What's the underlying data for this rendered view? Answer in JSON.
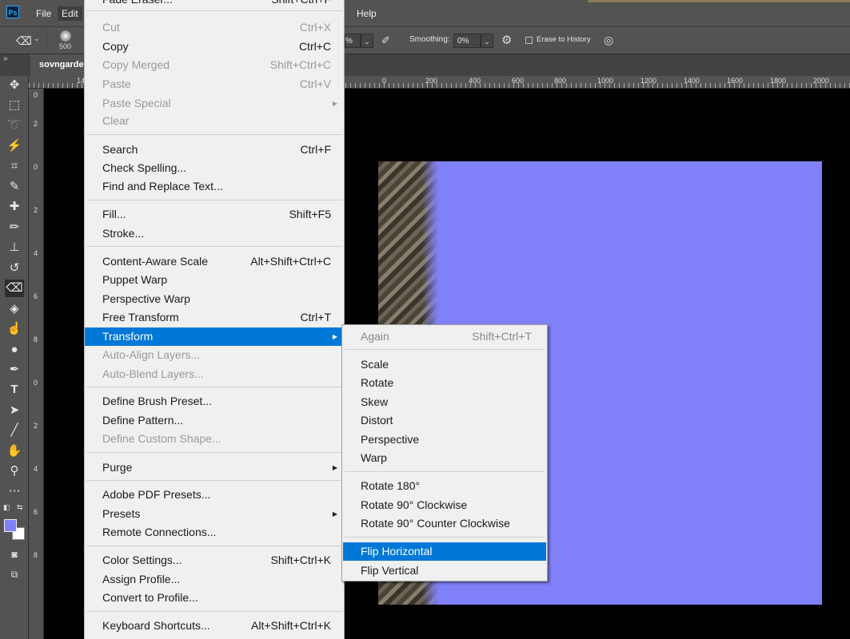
{
  "app": {
    "logo": "Ps"
  },
  "menubar": {
    "items": [
      "File",
      "Edit"
    ],
    "right_items": [
      "Help"
    ]
  },
  "options": {
    "brush_size": "500",
    "opacity_value": "%",
    "smoothing_label": "Smoothing:",
    "smoothing_value": "0%",
    "erase_to_history": "Erase to History",
    "collapse_marker": "»"
  },
  "document": {
    "tab_title": "sovngarde"
  },
  "ruler": {
    "left_fragment": "14",
    "labels": [
      "0",
      "200",
      "400",
      "600",
      "800",
      "1000",
      "1200",
      "1400",
      "1600",
      "1800",
      "2000"
    ],
    "vertical": [
      "0",
      "2",
      "0",
      "2",
      "4",
      "6",
      "8",
      "0",
      "2",
      "4",
      "6",
      "8"
    ]
  },
  "edit_menu": {
    "top_partial": {
      "label": "Fade Eraser...",
      "shortcut": "Shift+Ctrl+F"
    },
    "items": [
      {
        "label": "Cut",
        "shortcut": "Ctrl+X",
        "disabled": true
      },
      {
        "label": "Copy",
        "shortcut": "Ctrl+C"
      },
      {
        "label": "Copy Merged",
        "shortcut": "Shift+Ctrl+C",
        "disabled": true
      },
      {
        "label": "Paste",
        "shortcut": "Ctrl+V",
        "disabled": true
      },
      {
        "label": "Paste Special",
        "shortcut": "",
        "disabled": true,
        "submenu": true
      },
      {
        "label": "Clear",
        "shortcut": "",
        "disabled": true
      },
      {
        "label": "Search",
        "shortcut": "Ctrl+F"
      },
      {
        "label": "Check Spelling...",
        "shortcut": ""
      },
      {
        "label": "Find and Replace Text...",
        "shortcut": ""
      },
      {
        "label": "Fill...",
        "shortcut": "Shift+F5"
      },
      {
        "label": "Stroke...",
        "shortcut": ""
      },
      {
        "label": "Content-Aware Scale",
        "shortcut": "Alt+Shift+Ctrl+C"
      },
      {
        "label": "Puppet Warp",
        "shortcut": ""
      },
      {
        "label": "Perspective Warp",
        "shortcut": ""
      },
      {
        "label": "Free Transform",
        "shortcut": "Ctrl+T"
      },
      {
        "label": "Transform",
        "shortcut": "",
        "highlighted": true,
        "submenu": true
      },
      {
        "label": "Auto-Align Layers...",
        "shortcut": "",
        "disabled": true
      },
      {
        "label": "Auto-Blend Layers...",
        "shortcut": "",
        "disabled": true
      },
      {
        "label": "Define Brush Preset...",
        "shortcut": ""
      },
      {
        "label": "Define Pattern...",
        "shortcut": ""
      },
      {
        "label": "Define Custom Shape...",
        "shortcut": "",
        "disabled": true
      },
      {
        "label": "Purge",
        "shortcut": "",
        "submenu": true
      },
      {
        "label": "Adobe PDF Presets...",
        "shortcut": ""
      },
      {
        "label": "Presets",
        "shortcut": "",
        "submenu": true
      },
      {
        "label": "Remote Connections...",
        "shortcut": ""
      },
      {
        "label": "Color Settings...",
        "shortcut": "Shift+Ctrl+K"
      },
      {
        "label": "Assign Profile...",
        "shortcut": ""
      },
      {
        "label": "Convert to Profile...",
        "shortcut": ""
      },
      {
        "label": "Keyboard Shortcuts...",
        "shortcut": "Alt+Shift+Ctrl+K"
      }
    ]
  },
  "transform_submenu": {
    "items": [
      {
        "label": "Again",
        "shortcut": "Shift+Ctrl+T",
        "disabled": true
      },
      {
        "label": "Scale",
        "shortcut": ""
      },
      {
        "label": "Rotate",
        "shortcut": ""
      },
      {
        "label": "Skew",
        "shortcut": ""
      },
      {
        "label": "Distort",
        "shortcut": ""
      },
      {
        "label": "Perspective",
        "shortcut": ""
      },
      {
        "label": "Warp",
        "shortcut": ""
      },
      {
        "label": "Rotate 180°",
        "shortcut": ""
      },
      {
        "label": "Rotate 90° Clockwise",
        "shortcut": ""
      },
      {
        "label": "Rotate 90° Counter Clockwise",
        "shortcut": ""
      },
      {
        "label": "Flip Horizontal",
        "shortcut": "",
        "highlighted": true
      },
      {
        "label": "Flip Vertical",
        "shortcut": ""
      }
    ]
  },
  "colors": {
    "foreground": "#8080f8",
    "background": "#ffffff",
    "highlight": "#0078d7"
  }
}
